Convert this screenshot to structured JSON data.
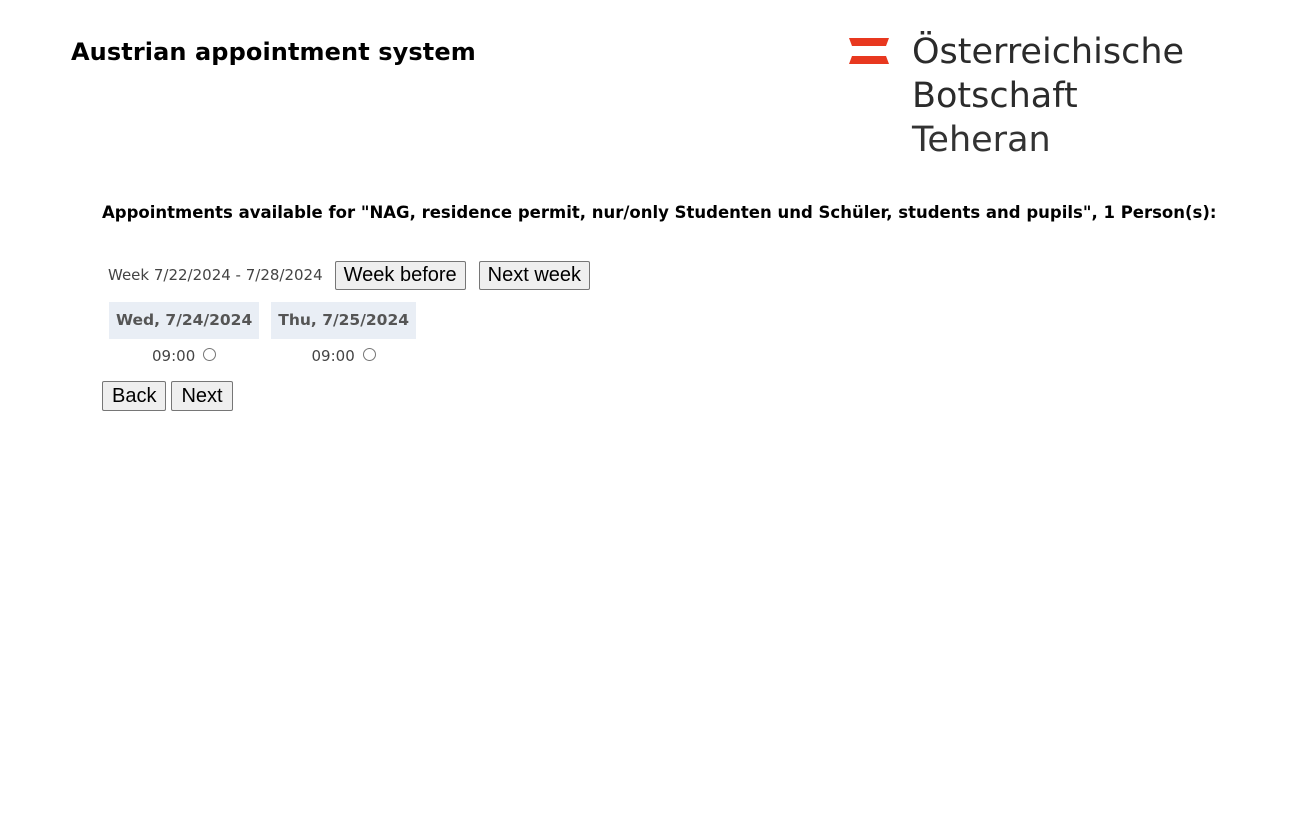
{
  "header": {
    "title": "Austrian appointment system",
    "logo": {
      "line1": "Österreichische",
      "line2": "Botschaft",
      "line3": "Teheran",
      "flag_color": "#e8381f"
    }
  },
  "main": {
    "heading": "Appointments available for \"NAG, residence permit, nur/only Studenten und Schüler, students and pupils\", 1 Person(s):",
    "week": {
      "label": "Week 7/22/2024 - 7/28/2024",
      "prev_label": "Week before",
      "next_label": "Next week"
    },
    "days": [
      {
        "date": "Wed, 7/24/2024",
        "slots": [
          {
            "time": "09:00",
            "selected": false
          }
        ]
      },
      {
        "date": "Thu, 7/25/2024",
        "slots": [
          {
            "time": "09:00",
            "selected": false
          }
        ]
      }
    ],
    "nav": {
      "back_label": "Back",
      "next_label": "Next"
    }
  }
}
